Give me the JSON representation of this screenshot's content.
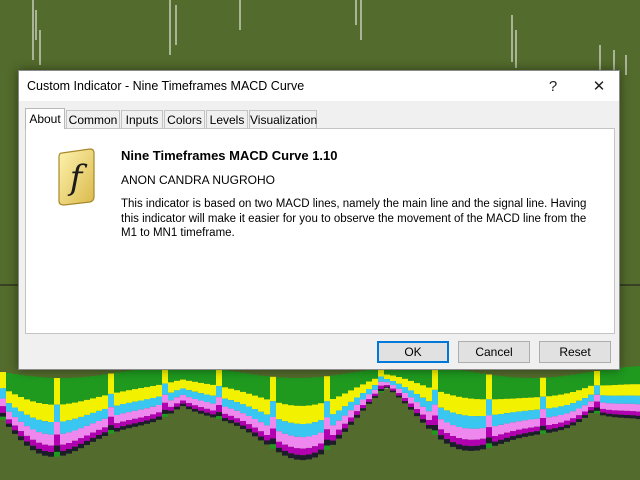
{
  "window": {
    "title": "Custom Indicator - Nine Timeframes MACD Curve",
    "help_glyph": "?",
    "close_glyph": "✕"
  },
  "tabs": [
    {
      "label": "About",
      "active": true
    },
    {
      "label": "Common",
      "active": false
    },
    {
      "label": "Inputs",
      "active": false
    },
    {
      "label": "Colors",
      "active": false
    },
    {
      "label": "Levels",
      "active": false
    },
    {
      "label": "Visualization",
      "active": false
    }
  ],
  "about": {
    "icon": "script-f-icon",
    "icon_glyph": "f",
    "title": "Nine Timeframes MACD Curve 1.10",
    "author": "ANON CANDRA NUGROHO",
    "description": "This indicator is based on two MACD lines, namely the main line and the signal line. Having this indicator will make it easier for you to observe the movement of the MACD line from the M1 to MN1 timeframe."
  },
  "buttons": {
    "ok": "OK",
    "cancel": "Cancel",
    "reset": "Reset"
  },
  "colors": {
    "chart_background": "#536b2c",
    "indicator_palette": [
      "#1f9a1f",
      "#f2f200",
      "#39c6f0",
      "#ee88ee",
      "#b000b0",
      "#1c1c2a",
      "#ffffff"
    ],
    "button_focus": "#0078d7"
  }
}
